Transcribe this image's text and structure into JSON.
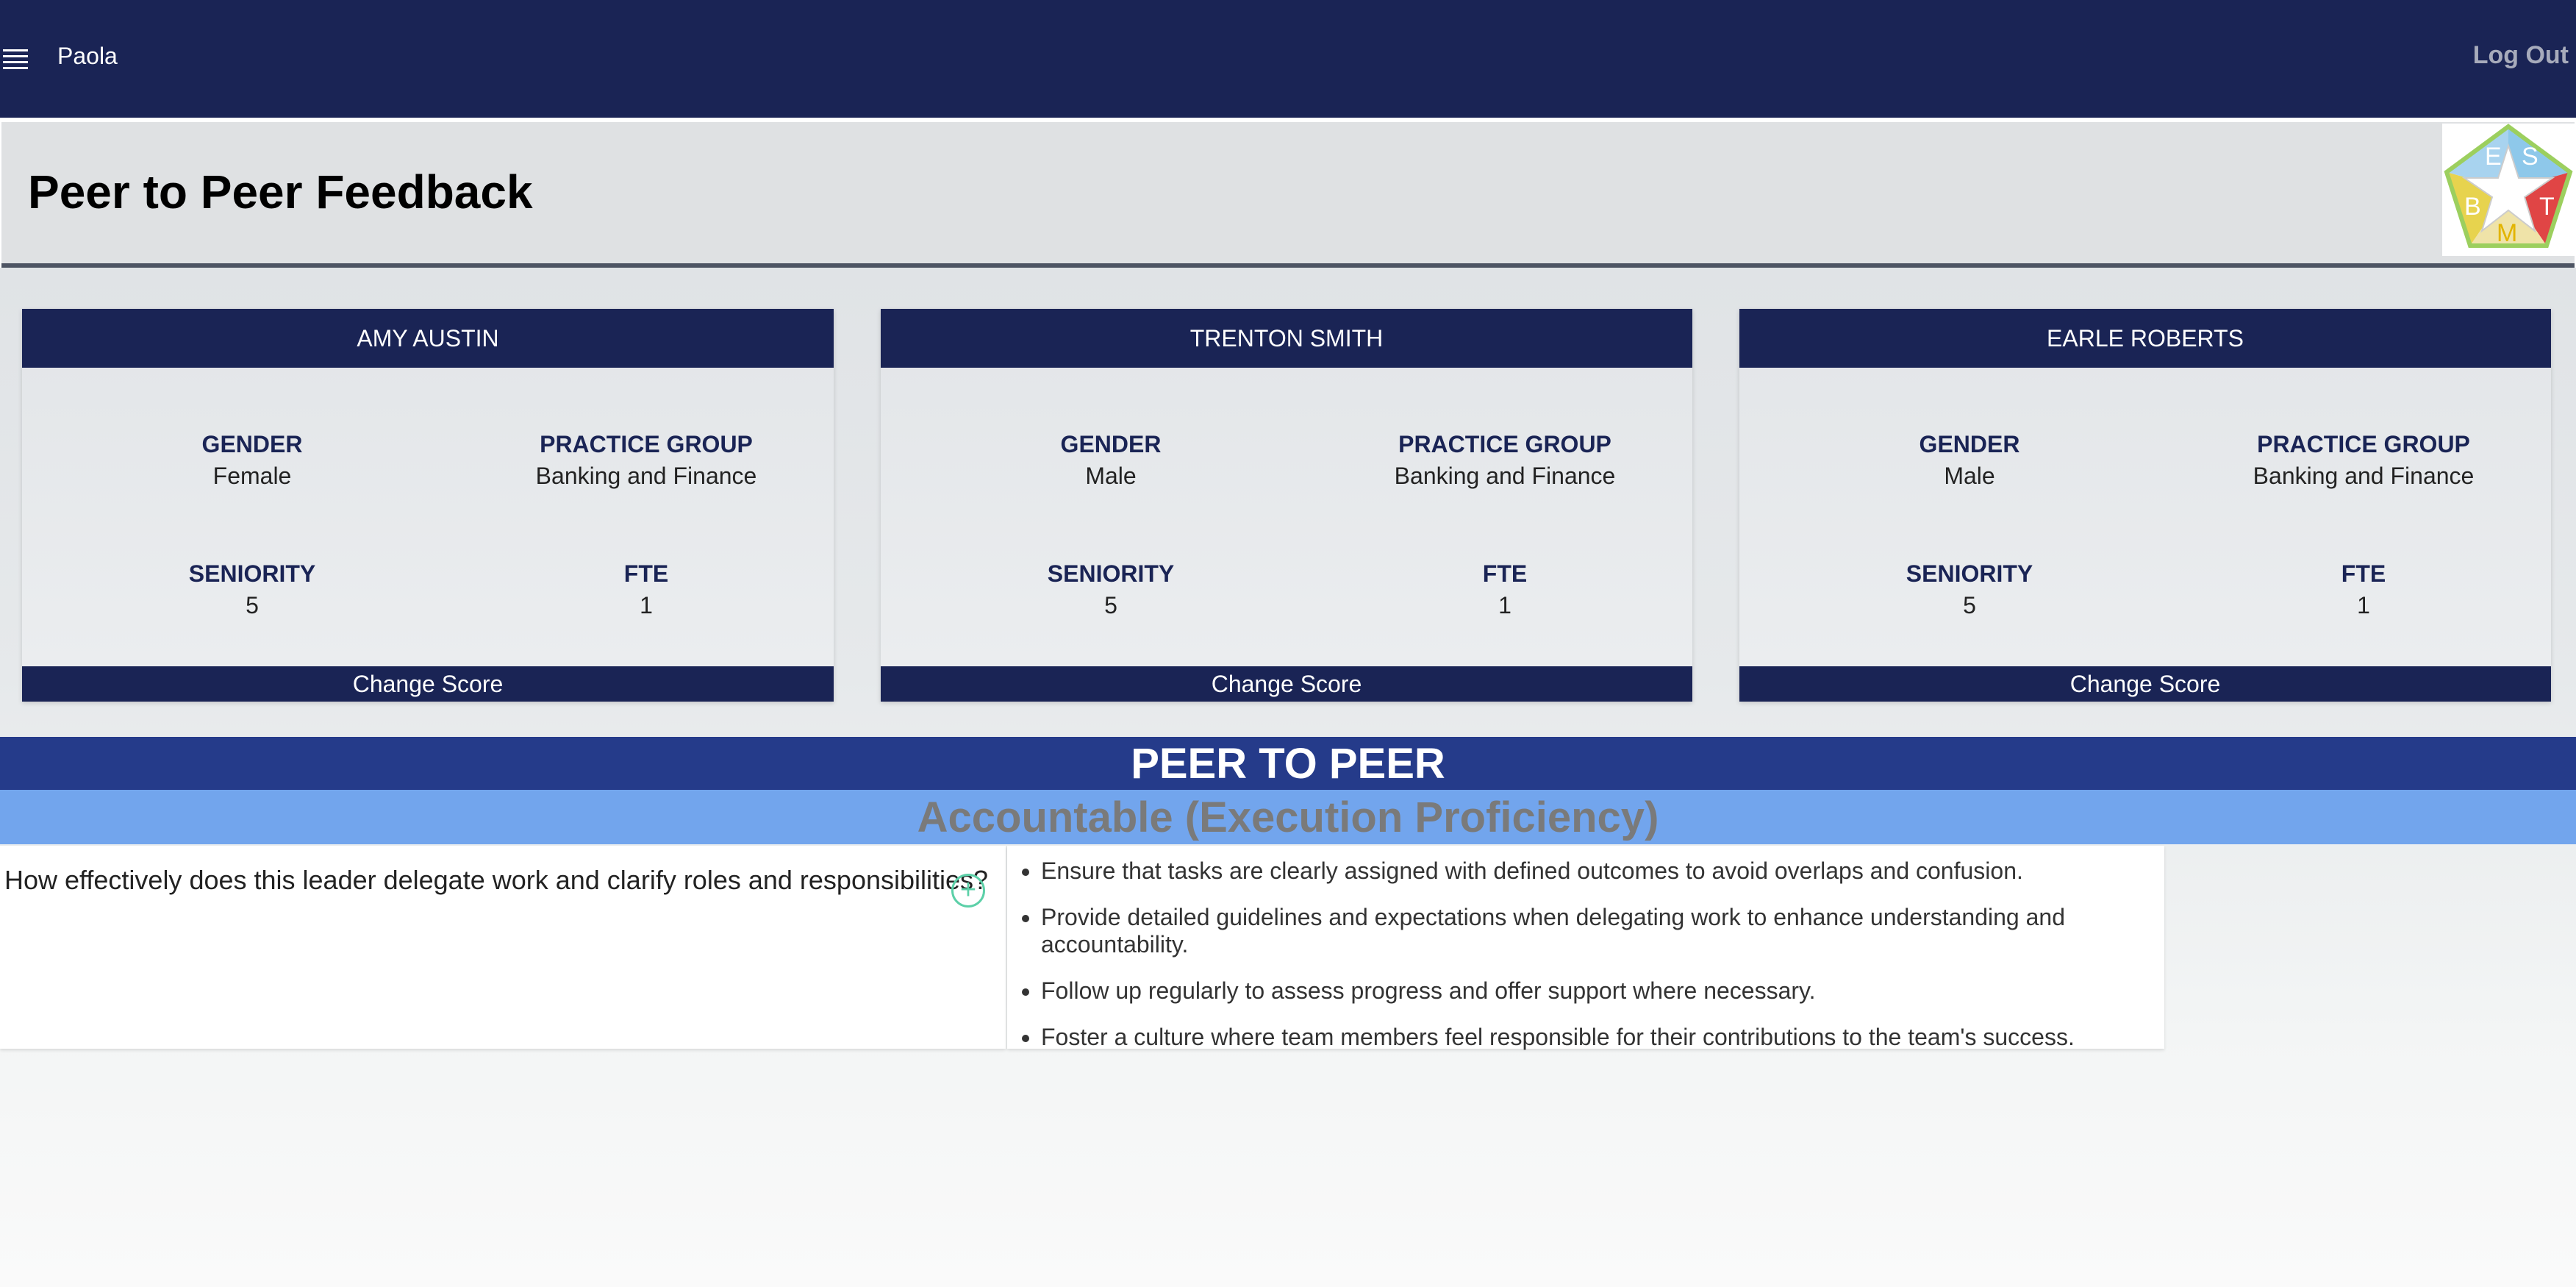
{
  "topbar": {
    "username": "Paola",
    "logout_label": "Log Out",
    "menu_icon": "hamburger-menu-icon"
  },
  "header": {
    "title": "Peer to Peer Feedback",
    "logo_letters": [
      "E",
      "S",
      "B",
      "T",
      "M"
    ]
  },
  "cards": [
    {
      "name": "AMY AUSTIN",
      "gender_label": "GENDER",
      "gender": "Female",
      "practice_label": "PRACTICE GROUP",
      "practice": "Banking and Finance",
      "seniority_label": "SENIORITY",
      "seniority": "5",
      "fte_label": "FTE",
      "fte": "1",
      "action_label": "Change Score"
    },
    {
      "name": "TRENTON SMITH",
      "gender_label": "GENDER",
      "gender": "Male",
      "practice_label": "PRACTICE GROUP",
      "practice": "Banking and Finance",
      "seniority_label": "SENIORITY",
      "seniority": "5",
      "fte_label": "FTE",
      "fte": "1",
      "action_label": "Change Score"
    },
    {
      "name": "EARLE ROBERTS",
      "gender_label": "GENDER",
      "gender": "Male",
      "practice_label": "PRACTICE GROUP",
      "practice": "Banking and Finance",
      "seniority_label": "SENIORITY",
      "seniority": "5",
      "fte_label": "FTE",
      "fte": "1",
      "action_label": "Change Score"
    }
  ],
  "section": {
    "title": "PEER TO PEER",
    "category": "Accountable (Execution Proficiency)"
  },
  "question": {
    "text": "How effectively does this leader delegate work and clarify roles and responsibilities?",
    "add_icon": "plus-circle-icon",
    "tips": [
      "Ensure that tasks are clearly assigned with defined outcomes to avoid overlaps and confusion.",
      "Provide detailed guidelines and expectations when delegating work to enhance understanding and accountability.",
      "Follow up regularly to assess progress and offer support where necessary.",
      "Foster a culture where team members feel responsible for their contributions to the team's success."
    ]
  },
  "colors": {
    "navy": "#1a2455",
    "section_blue": "#253b8a",
    "category_blue": "#72a5ed",
    "accent_green": "#5cd0a8"
  }
}
